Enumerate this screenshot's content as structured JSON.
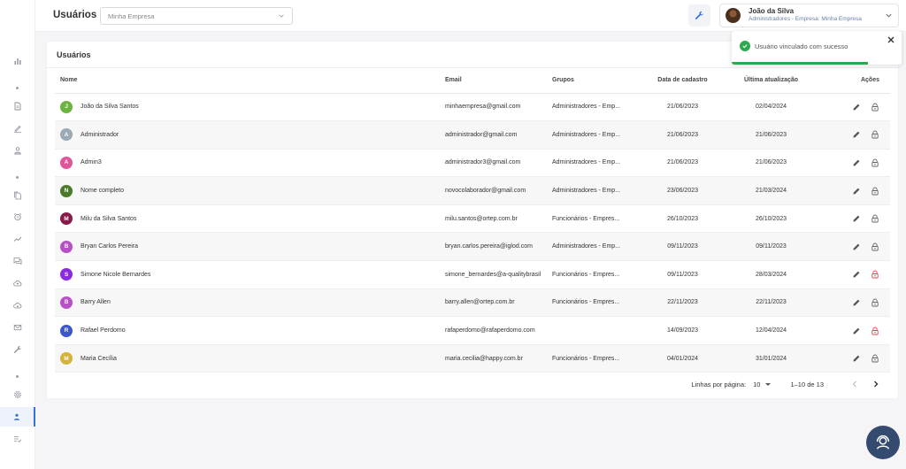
{
  "header": {
    "title": "Usuários",
    "company_select": "Minha Empresa",
    "user_name": "João da Silva",
    "user_role": "Administradores - Empresa: Minha Empresa"
  },
  "card": {
    "title": "Usuários",
    "columns": {
      "nome": "Nome",
      "email": "Email",
      "grupos": "Grupos",
      "cadastro": "Data de cadastro",
      "atualizacao": "Última atualização",
      "acoes": "Ações"
    },
    "rows": [
      {
        "initial": "J",
        "color": "#6cb33f",
        "name": "João da Silva Santos",
        "email": "minhaempresa@gmail.com",
        "group": "Administradores - Emp...",
        "created": "21/06/2023",
        "updated": "02/04/2024",
        "lock_color": "#666"
      },
      {
        "initial": "A",
        "color": "#9aaab6",
        "name": "Administrador",
        "email": "administrador@gmail.com",
        "group": "Administradores - Emp...",
        "created": "21/06/2023",
        "updated": "21/06/2023",
        "lock_color": "#666"
      },
      {
        "initial": "A",
        "color": "#e0559a",
        "name": "Admin3",
        "email": "administrador3@gmail.com",
        "group": "Administradores - Emp...",
        "created": "21/06/2023",
        "updated": "21/06/2023",
        "lock_color": "#666"
      },
      {
        "initial": "N",
        "color": "#4a7a2a",
        "name": "Nome completo",
        "email": "novocolaborador@gmail.com",
        "group": "Administradores - Emp...",
        "created": "23/06/2023",
        "updated": "21/03/2024",
        "lock_color": "#666"
      },
      {
        "initial": "M",
        "color": "#8a1a4a",
        "name": "Milu da Silva Santos",
        "email": "milu.santos@ortep.com.br",
        "group": "Funcionários - Empres...",
        "created": "26/10/2023",
        "updated": "26/10/2023",
        "lock_color": "#666"
      },
      {
        "initial": "B",
        "color": "#b84fc9",
        "name": "Bryan Carlos Pereira",
        "email": "bryan.carlos.pereira@iglod.com",
        "group": "Administradores - Emp...",
        "created": "09/11/2023",
        "updated": "09/11/2023",
        "lock_color": "#666"
      },
      {
        "initial": "S",
        "color": "#8a2be2",
        "name": "Simone Nicole Bernardes",
        "email": "simone_bernardes@a-qualitybrasil",
        "group": "Funcionários - Empres...",
        "created": "09/11/2023",
        "updated": "28/03/2024",
        "lock_color": "#e0455a"
      },
      {
        "initial": "B",
        "color": "#b84fc9",
        "name": "Barry Allen",
        "email": "barry.allen@ortep.com.br",
        "group": "Funcionários - Empres...",
        "created": "22/11/2023",
        "updated": "22/11/2023",
        "lock_color": "#666"
      },
      {
        "initial": "R",
        "color": "#3c57c9",
        "name": "Rafael Perdomo",
        "email": "rafaperdomo@rafaperdomo.com",
        "group": "",
        "created": "14/09/2023",
        "updated": "12/04/2024",
        "lock_color": "#e0455a"
      },
      {
        "initial": "M",
        "color": "#d4b33a",
        "name": "Maria Cecília",
        "email": "maria.cecilia@happy.com.br",
        "group": "Funcionários - Empres...",
        "created": "04/01/2024",
        "updated": "31/01/2024",
        "lock_color": "#666"
      }
    ]
  },
  "pagination": {
    "label": "Linhas por página:",
    "per_page": "10",
    "range": "1–10 de 13"
  },
  "toast": {
    "message": "Usuário vinculado com sucesso",
    "progress": 0.8
  },
  "colors": {
    "accent": "#3a6fd8",
    "success": "#2ea84f",
    "danger": "#e0455a",
    "help_fab": "#344a6e"
  },
  "sidebar_icons": [
    "bar-chart-icon",
    "document-icon",
    "pen-icon",
    "person-icon",
    "files-icon",
    "alarm-icon",
    "trend-icon",
    "chat-icon",
    "cloud-upload-icon",
    "cloud-download-icon",
    "mail-icon",
    "wrench-icon",
    "gear-icon",
    "users-icon",
    "checklist-icon"
  ]
}
